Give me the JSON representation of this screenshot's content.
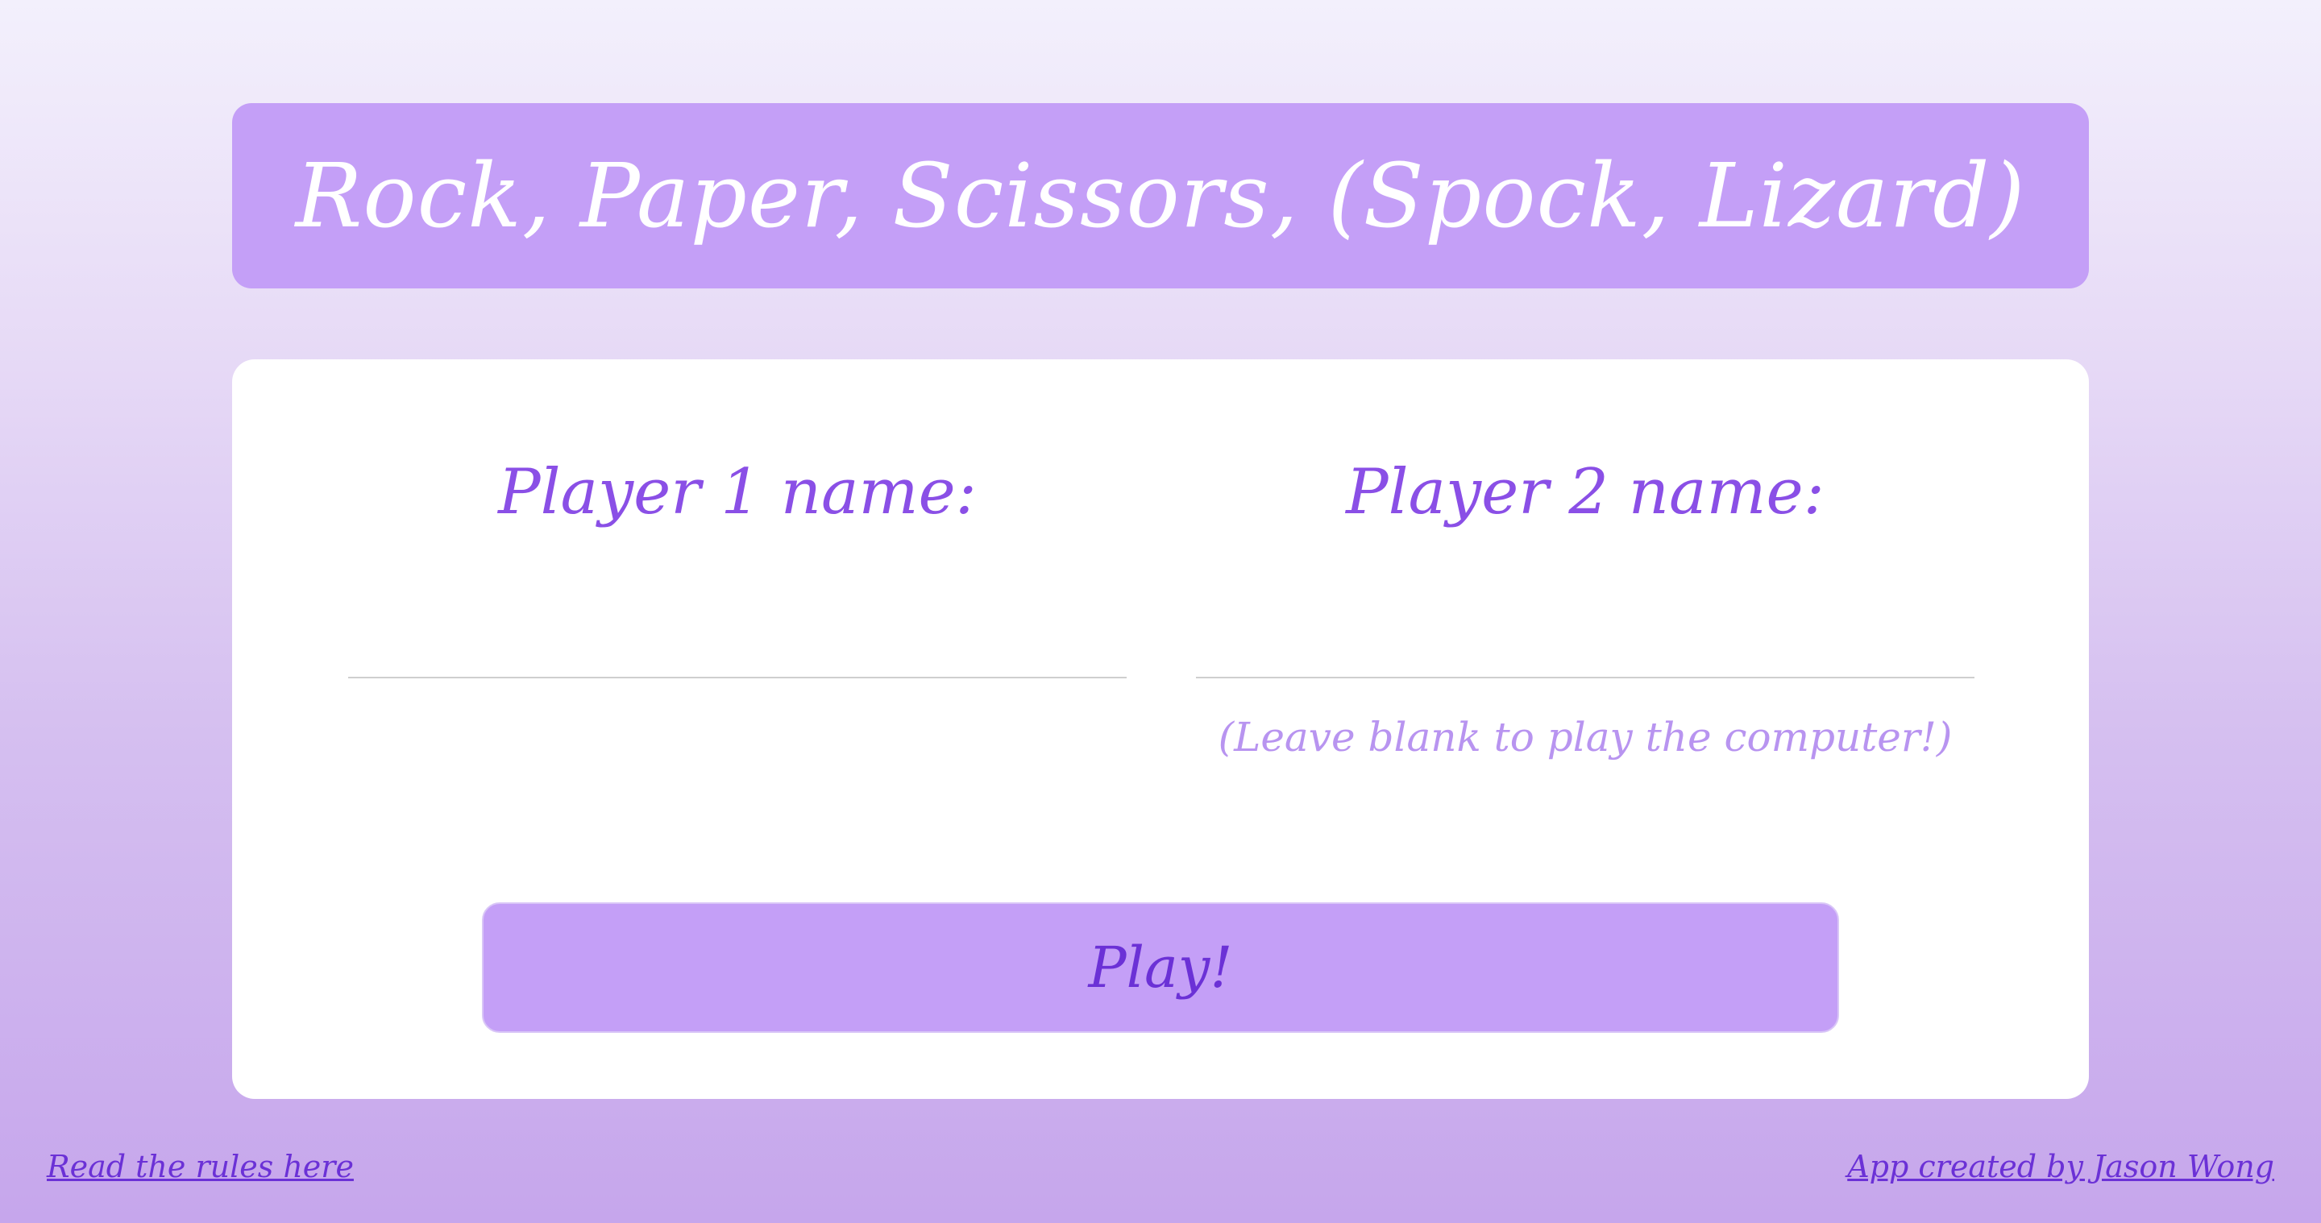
{
  "header": {
    "title": "Rock, Paper, Scissors, (Spock, Lizard)"
  },
  "form": {
    "player1_label": "Player 1 name:",
    "player1_value": "",
    "player2_label": "Player 2 name:",
    "player2_value": "",
    "player2_hint": "(Leave blank to play the computer!)",
    "play_label": "Play!"
  },
  "footer": {
    "rules_link": "Read the rules here",
    "credit_link": "App created by Jason Wong"
  },
  "colors": {
    "accent": "#c49ff7",
    "text_purple": "#8a4fe6",
    "hint_purple": "#b894f0",
    "link_purple": "#6b31d6",
    "card_bg": "#ffffff"
  }
}
